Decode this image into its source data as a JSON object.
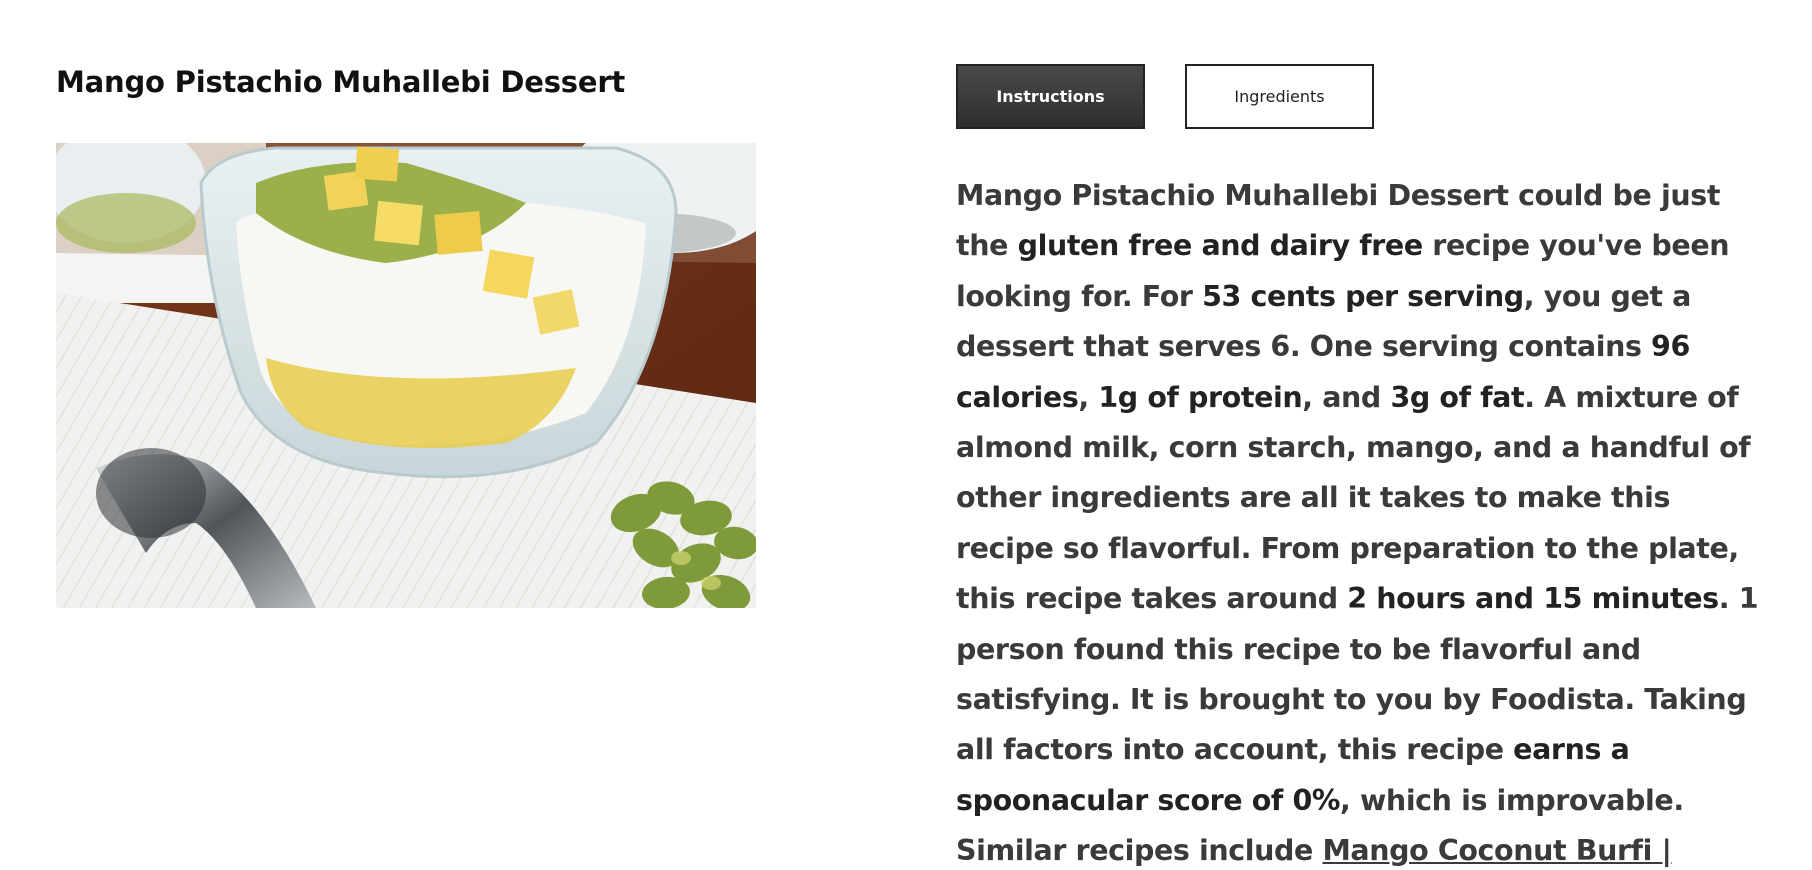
{
  "recipe": {
    "title": "Mango Pistachio Muhallebi Dessert"
  },
  "tabs": {
    "instructions_label": "Instructions",
    "ingredients_label": "Ingredients"
  },
  "summary": {
    "t1": "Mango Pistachio Muhallebi Dessert could be just the ",
    "b1": "gluten free and dairy free",
    "t2": " recipe you've been looking for. For ",
    "b2": "53 cents per serving",
    "t3": ", you get a dessert that serves 6. One serving contains ",
    "b3": "96 calories",
    "t4": ", ",
    "b4": "1g of protein",
    "t5": ", and ",
    "b5": "3g of fat",
    "t6": ". A mixture of almond milk, corn starch, mango, and a handful of other ingredients are all it takes to make this recipe so flavorful. From preparation to the plate, this recipe takes around ",
    "b6": "2 hours and 15 minutes",
    "t7": ". 1 person found this recipe to be flavorful and satisfying. It is brought to you by Foodista. Taking all factors into account, this recipe ",
    "b7": "earns a spoonacular score of 0%",
    "t8": ", which is improvable. Similar recipes include ",
    "link1": "Mango Coconut Burfi |"
  },
  "colors": {
    "active_tab_bg": "#3a3a3a",
    "text": "#333333"
  }
}
